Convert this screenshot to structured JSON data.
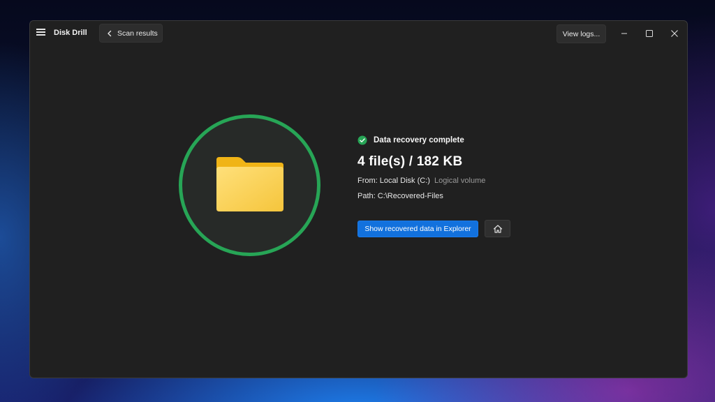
{
  "app": {
    "title": "Disk Drill"
  },
  "toolbar": {
    "back_label": "Scan results",
    "logs_label": "View logs..."
  },
  "icons": {
    "menu": "hamburger-icon",
    "back": "chevron-left-icon",
    "minimize": "minimize-icon",
    "maximize": "maximize-icon",
    "close": "close-icon",
    "hero": "folder-icon",
    "status": "check-circle-icon",
    "home": "home-icon"
  },
  "result": {
    "status": "Data recovery complete",
    "summary": "4 file(s) / 182 KB",
    "from_label": "From:",
    "from_value": "Local Disk (C:)",
    "from_type": "Logical volume",
    "path_label": "Path:",
    "path_value": "C:\\Recovered-Files"
  },
  "actions": {
    "show_label": "Show recovered data in Explorer"
  },
  "colors": {
    "accent": "#1271dd",
    "success": "#27a556",
    "folder": "#f7c948",
    "window_bg": "#202020"
  }
}
